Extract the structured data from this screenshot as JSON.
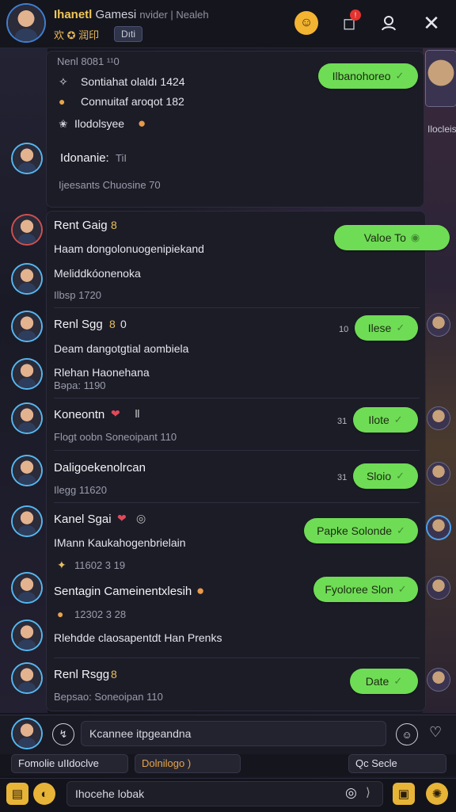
{
  "header": {
    "title_highlight": "Ihanetl",
    "title_rest": "Gamesi",
    "title_tail": "nvider | Nealeh",
    "subtitle": "欢 ✪ 润印",
    "tag": "Dıti"
  },
  "card1": {
    "header": "Nenl 8081 ¹¹0",
    "lines": [
      "Sontiahat olaldı 1424",
      "Connuitaf aroqot 182",
      "Ilodolsyee"
    ],
    "name": "Idonanie:",
    "name_count": "TiI",
    "meta": "Ijeesants Chuosine 70"
  },
  "card2": {
    "rows": [
      {
        "name": "Rent Gaig",
        "badge": "8",
        "text": "Haam dongolonuogenipiekand"
      },
      {
        "name": "",
        "text": "Meliddkóonenoka",
        "meta": "Ilbsp 1720"
      },
      {
        "name": "Renl Sgg",
        "badge": "8",
        "badge2": "0",
        "text": "Deam dangotgtial aombiela"
      },
      {
        "name": "",
        "text": "Rlehan Haonehana",
        "meta": "Bəpa: 1190"
      },
      {
        "name": "Koneontn",
        "text": "",
        "meta": "Flogt oobn Soneoipant 110"
      },
      {
        "name": "Daligoekenolrcan",
        "meta": "Ilegg 11620"
      },
      {
        "name": "Kanel Sgai",
        "text": "IMann Kaukahogenbrielain",
        "meta": "11602 3 19"
      },
      {
        "name": "Sentagin Cameinentxlesih",
        "meta": "12302 3 28"
      },
      {
        "name": "",
        "text": "Rlehdde claosapentdt Han Prenks"
      },
      {
        "name": "Renl Rsgg",
        "badge": "8",
        "meta": "Bepsao: Soneoipan 110"
      }
    ]
  },
  "bubbles": [
    {
      "label": "Ilbanohoreo",
      "count": ""
    },
    {
      "label": "Valoe To",
      "count": ""
    },
    {
      "label": "Ilese",
      "count": "10"
    },
    {
      "label": "Ilote",
      "count": "31"
    },
    {
      "label": "Sloio",
      "count": "31"
    },
    {
      "label": "Papke Solonde",
      "count": ""
    },
    {
      "label": "Fyoloree Slon",
      "count": ""
    },
    {
      "label": "Date",
      "count": ""
    }
  ],
  "side_label": "Ilocleis",
  "compose": {
    "placeholder": "Kcannee itpgeandna"
  },
  "chips": {
    "left": "Fomolie uIIdoclve",
    "middle": "Dolnilogo )",
    "right": "Qc Secle"
  },
  "bottom": {
    "input": "Ihocehe lobak"
  },
  "colors": {
    "bubble": "#6fdc55",
    "accent_gold": "#e9c05a",
    "bg": "#121219"
  }
}
